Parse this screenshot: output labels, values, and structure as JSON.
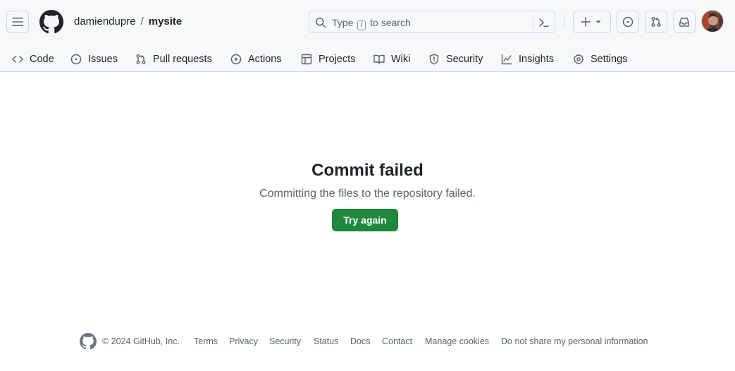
{
  "header": {
    "owner": "damiendupre",
    "separator": "/",
    "repo": "mysite",
    "search": {
      "placeholder_before": "Type",
      "slash_key": "/",
      "placeholder_after": "to search"
    }
  },
  "tabs": [
    {
      "label": "Code",
      "icon": "code-icon"
    },
    {
      "label": "Issues",
      "icon": "issue-opened-icon"
    },
    {
      "label": "Pull requests",
      "icon": "git-pull-request-icon"
    },
    {
      "label": "Actions",
      "icon": "play-icon"
    },
    {
      "label": "Projects",
      "icon": "table-icon"
    },
    {
      "label": "Wiki",
      "icon": "book-icon"
    },
    {
      "label": "Security",
      "icon": "shield-icon"
    },
    {
      "label": "Insights",
      "icon": "graph-icon"
    },
    {
      "label": "Settings",
      "icon": "gear-icon"
    }
  ],
  "main": {
    "title": "Commit failed",
    "description": "Committing the files to the repository failed.",
    "button": "Try again"
  },
  "footer": {
    "copyright": "© 2024 GitHub, Inc.",
    "links": [
      "Terms",
      "Privacy",
      "Security",
      "Status",
      "Docs",
      "Contact",
      "Manage cookies",
      "Do not share my personal information"
    ]
  },
  "colors": {
    "accent_green": "#1f883d",
    "header_bg": "#f6f8fa",
    "border": "#d0d7de",
    "muted_text": "#59636e"
  }
}
